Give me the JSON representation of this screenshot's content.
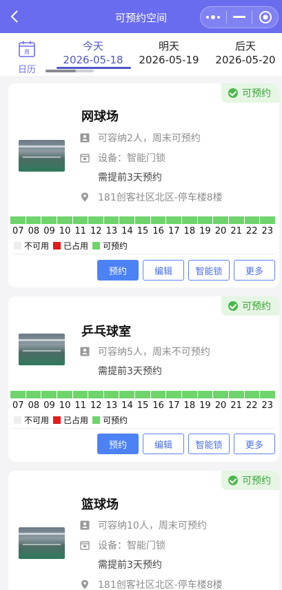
{
  "header": {
    "title": "可预约空间"
  },
  "calendar": {
    "label": "日历",
    "icon_text": "周"
  },
  "tabs": [
    {
      "day": "今天",
      "date": "2026-05-18",
      "active": true
    },
    {
      "day": "明天",
      "date": "2026-05-19",
      "active": false
    },
    {
      "day": "后天",
      "date": "2026-05-20",
      "active": false
    }
  ],
  "hours": [
    "07",
    "08",
    "09",
    "10",
    "11",
    "12",
    "13",
    "14",
    "15",
    "16",
    "17",
    "18",
    "19",
    "20",
    "21",
    "22",
    "23"
  ],
  "legend": {
    "unavailable": "不可用",
    "occupied": "已占用",
    "available": "可预约"
  },
  "colors": {
    "unavailable": "#eeeeee",
    "occupied": "#e21b1b",
    "available": "#6ed46b",
    "accent": "#6a6cf0"
  },
  "actions": {
    "book": "预约",
    "edit": "编辑",
    "smart_lock": "智能锁",
    "more": "更多"
  },
  "spaces": [
    {
      "name": "网球场",
      "status": "可预约",
      "capacity": "可容纳2人，周末可预约",
      "equipment": "设备：智能门锁",
      "advance": "需提前3天预约",
      "location": "181创客社区北区-停车楼8楼"
    },
    {
      "name": "乒乓球室",
      "status": "可预约",
      "capacity": "可容纳5人，周末不可预约",
      "advance": "需提前3天预约"
    },
    {
      "name": "篮球场",
      "status": "可预约",
      "capacity": "可容纳10人，周末可预约",
      "equipment": "设备：智能门锁",
      "advance": "需提前3天预约",
      "location": "181创客社区北区-停车楼8楼"
    }
  ]
}
